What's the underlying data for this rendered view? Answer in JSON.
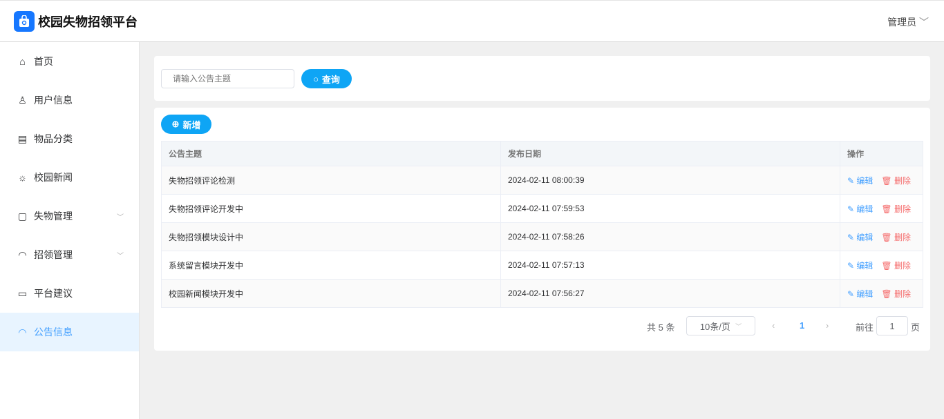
{
  "app": {
    "title": "校园失物招领平台",
    "user": "管理员"
  },
  "sidebar": {
    "items": [
      {
        "label": "首页",
        "icon": "home-icon"
      },
      {
        "label": "用户信息",
        "icon": "user-icon"
      },
      {
        "label": "物品分类",
        "icon": "category-icon"
      },
      {
        "label": "校园新闻",
        "icon": "sun-icon"
      },
      {
        "label": "失物管理",
        "icon": "lost-icon"
      },
      {
        "label": "招领管理",
        "icon": "bell-icon"
      },
      {
        "label": "平台建议",
        "icon": "chat-icon"
      },
      {
        "label": "公告信息",
        "icon": "bell-icon"
      }
    ]
  },
  "search": {
    "placeholder": "请输入公告主题",
    "button": "查询"
  },
  "toolbar": {
    "add": "新增"
  },
  "table": {
    "headers": [
      "公告主题",
      "发布日期",
      "操作"
    ],
    "rows": [
      [
        "失物招领评论检测",
        "2024-02-11 08:00:39"
      ],
      [
        "失物招领评论开发中",
        "2024-02-11 07:59:53"
      ],
      [
        "失物招领模块设计中",
        "2024-02-11 07:58:26"
      ],
      [
        "系统留言模块开发中",
        "2024-02-11 07:57:13"
      ],
      [
        "校园新闻模块开发中",
        "2024-02-11 07:56:27"
      ]
    ],
    "edit": "编辑",
    "delete": "删除"
  },
  "pagination": {
    "total": "共 5 条",
    "size": "10条/页",
    "page": "1",
    "goto": "前往",
    "goto_value": "1",
    "suffix": "页"
  }
}
